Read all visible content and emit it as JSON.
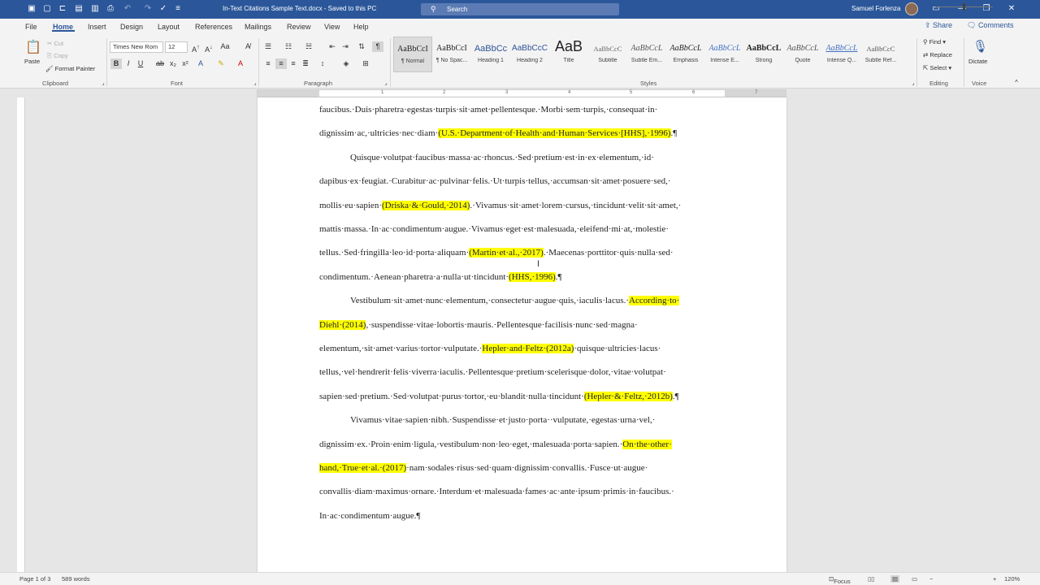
{
  "titlebar": {
    "doc_title": "In-Text Citations Sample Text.docx  -  Saved to this PC",
    "search_placeholder": "Search",
    "user_name": "Samuel Forlenza",
    "bg_color": "#2b579a"
  },
  "menu_tabs": [
    "File",
    "Home",
    "Insert",
    "Design",
    "Layout",
    "References",
    "Mailings",
    "Review",
    "View",
    "Help"
  ],
  "active_tab": "Home",
  "share_label": "Share",
  "comments_label": "Comments",
  "ribbon": {
    "clipboard": {
      "paste": "Paste",
      "cut": "Cut",
      "copy": "Copy",
      "format_painter": "Format Painter",
      "label": "Clipboard"
    },
    "font": {
      "name": "Times New Rom",
      "size": "12",
      "label": "Font"
    },
    "paragraph": {
      "label": "Paragraph"
    },
    "styles": {
      "label": "Styles",
      "items": [
        {
          "preview": "AaBbCcI",
          "name": "¶ Normal"
        },
        {
          "preview": "AaBbCcI",
          "name": "¶ No Spac..."
        },
        {
          "preview": "AaBbCc",
          "name": "Heading 1"
        },
        {
          "preview": "AaBbCcC",
          "name": "Heading 2"
        },
        {
          "preview": "AaB",
          "name": "Title"
        },
        {
          "preview": "AaBbCcC",
          "name": "Subtitle"
        },
        {
          "preview": "AaBbCcL",
          "name": "Subtle Em..."
        },
        {
          "preview": "AaBbCcL",
          "name": "Emphasis"
        },
        {
          "preview": "AaBbCcL",
          "name": "Intense E..."
        },
        {
          "preview": "AaBbCcL",
          "name": "Strong"
        },
        {
          "preview": "AaBbCcL",
          "name": "Quote"
        },
        {
          "preview": "AaBbCcL",
          "name": "Intense Q..."
        },
        {
          "preview": "AaBbCcC",
          "name": "Subtle Ref..."
        }
      ]
    },
    "editing": {
      "find": "Find",
      "replace": "Replace",
      "select": "Select",
      "label": "Editing"
    },
    "voice": {
      "dictate": "Dictate",
      "label": "Voice"
    }
  },
  "ruler_ticks": [
    "1",
    "2",
    "3",
    "4",
    "5",
    "6",
    "7"
  ],
  "document_lines": [
    [
      {
        "t": "faucibus.·Duis·pharetra·egestas·turpis·sit·amet·pellentesque.·Morbi·sem·turpis,·consequat·in·"
      }
    ],
    [
      {
        "t": "dignissim·ac,·ultricies·nec·diam·"
      },
      {
        "t": "(U.S.·Department·of·Health·and·Human·Services·[HHS],·1996)",
        "h": true
      },
      {
        "t": ".¶"
      }
    ],
    [
      {
        "t": "Quisque·volutpat·faucibus·massa·ac·rhoncus.·Sed·pretium·est·in·ex·elementum,·id·"
      }
    ],
    [
      {
        "t": "dapibus·ex·feugiat.·Curabitur·ac·pulvinar·felis.·Ut·turpis·tellus,·accumsan·sit·amet·posuere·sed,·"
      }
    ],
    [
      {
        "t": "mollis·eu·sapien·"
      },
      {
        "t": "(Driska·&·Gould,·2014)",
        "h": true
      },
      {
        "t": ".·Vivamus·sit·amet·lorem·cursus,·tincidunt·velit·sit·amet,·"
      }
    ],
    [
      {
        "t": "mattis·massa.·In·ac·condimentum·augue.·Vivamus·eget·est·malesuada,·eleifend·mi·at,·molestie·"
      }
    ],
    [
      {
        "t": "tellus.·Sed·fringilla·leo·id·porta·aliquam·"
      },
      {
        "t": "(Martin·et·al.,·2017)",
        "h": true
      },
      {
        "t": ".·Maecenas·porttitor·quis·nulla·sed·"
      }
    ],
    [
      {
        "t": "condimentum.·Aenean·pharetra·a·nulla·ut·tincidunt·"
      },
      {
        "t": "(HHS,·1996)",
        "h": true
      },
      {
        "t": ".¶"
      }
    ],
    [
      {
        "t": "Vestibulum·sit·amet·nunc·elementum,·consectetur·augue·quis,·iaculis·lacus.·"
      },
      {
        "t": "According·to·",
        "h": true
      }
    ],
    [
      {
        "t": "Diehl·(2014)",
        "h": true
      },
      {
        "t": ",·suspendisse·vitae·lobortis·mauris.·Pellentesque·facilisis·nunc·sed·magna·"
      }
    ],
    [
      {
        "t": "elementum,·sit·amet·varius·tortor·vulputate.·"
      },
      {
        "t": "Hepler·and·Feltz·(2012a)",
        "h": true
      },
      {
        "t": "·quisque·ultricies·lacus·"
      }
    ],
    [
      {
        "t": "tellus,·vel·hendrerit·felis·viverra·iaculis.·Pellentesque·pretium·scelerisque·dolor,·vitae·volutpat·"
      }
    ],
    [
      {
        "t": "sapien·sed·pretium.·Sed·volutpat·purus·tortor,·eu·blandit·nulla·tincidunt·"
      },
      {
        "t": "(Hepler·&·Feltz,·2012b)",
        "h": true
      },
      {
        "t": ".¶"
      }
    ],
    [
      {
        "t": "Vivamus·vitae·sapien·nibh.·Suspendisse·et·justo·porta··vulputate,·egestas·urna·vel,·"
      }
    ],
    [
      {
        "t": "dignissim·ex.·Proin·enim·ligula,·vestibulum·non·leo·eget,·malesuada·porta·sapien.·"
      },
      {
        "t": "On·the·other·",
        "h": true
      }
    ],
    [
      {
        "t": "hand,·True·et·al.·(2017)",
        "h": true
      },
      {
        "t": "·nam·sodales·risus·sed·quam·dignissim·convallis.·Fusce·ut·augue·"
      }
    ],
    [
      {
        "t": "convallis·diam·maximus·ornare.·Interdum·et·malesuada·fames·ac·ante·ipsum·primis·in·faucibus.·"
      }
    ],
    [
      {
        "t": "In·ac·condimentum·augue.¶"
      }
    ]
  ],
  "indented_lines": [
    2,
    8,
    13
  ],
  "statusbar": {
    "page": "Page 1 of 3",
    "words": "589 words",
    "focus": "Focus",
    "zoom": "120%"
  }
}
